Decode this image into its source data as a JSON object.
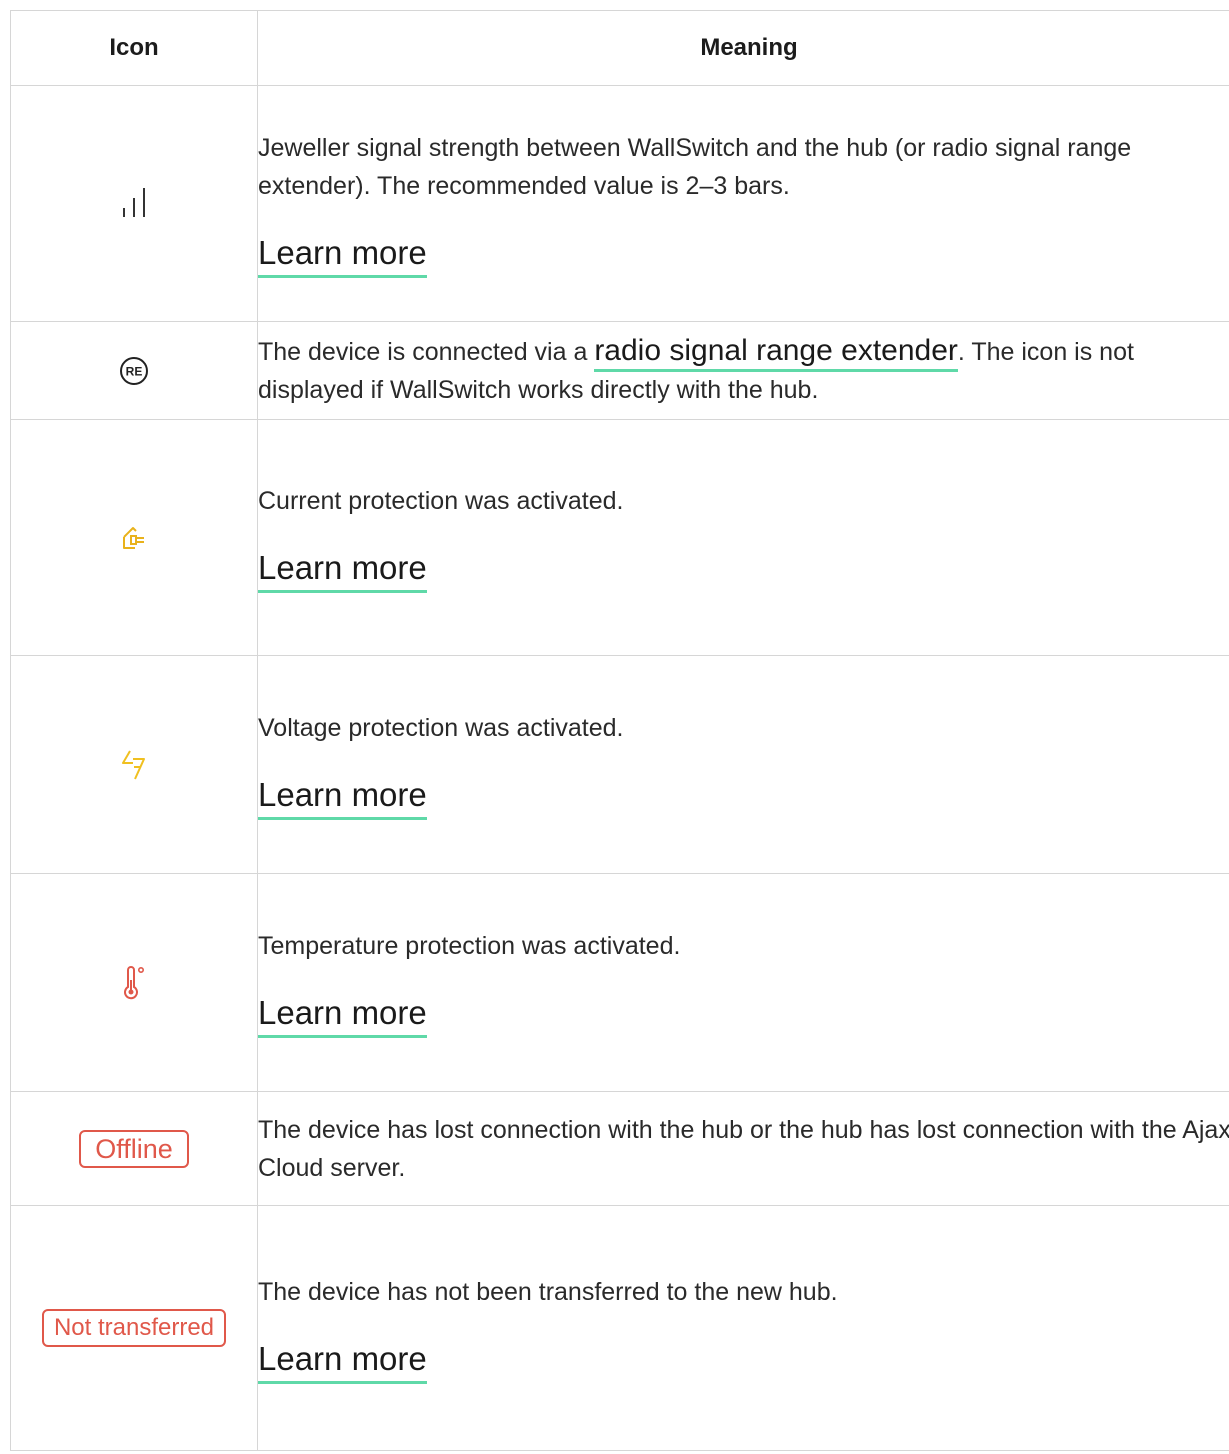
{
  "header": {
    "icon": "Icon",
    "meaning": "Meaning"
  },
  "rows": [
    {
      "icon": "signal-strength-icon",
      "text": "Jeweller signal strength between WallSwitch and the hub (or radio signal range extender). The recommended value is 2–3 bars.",
      "link": "Learn more"
    },
    {
      "icon": "range-extender-icon",
      "icon_text": "RE",
      "text_before": "The device is connected via a ",
      "link": "radio signal range extender",
      "text_after": ". The icon is not displayed if WallSwitch works directly with the hub."
    },
    {
      "icon": "current-protection-icon",
      "text": "Current protection was activated.",
      "link": "Learn more",
      "color": "#e9b21b"
    },
    {
      "icon": "voltage-protection-icon",
      "text": "Voltage protection was activated.",
      "link": "Learn more",
      "color": "#f0c020"
    },
    {
      "icon": "temperature-protection-icon",
      "text": "Temperature protection was activated.",
      "link": "Learn more",
      "color": "#e0584a"
    },
    {
      "badge": "Offline",
      "text": "The device has lost connection with the hub or the hub has lost connection with the Ajax Cloud server.",
      "color": "#e0584a"
    },
    {
      "badge": "Not transferred",
      "text": "The device has not been transferred to the new hub.",
      "link": "Learn more",
      "color": "#e0584a"
    }
  ],
  "colors": {
    "link_underline": "#5fd9a8",
    "border": "#d6d6d6"
  }
}
